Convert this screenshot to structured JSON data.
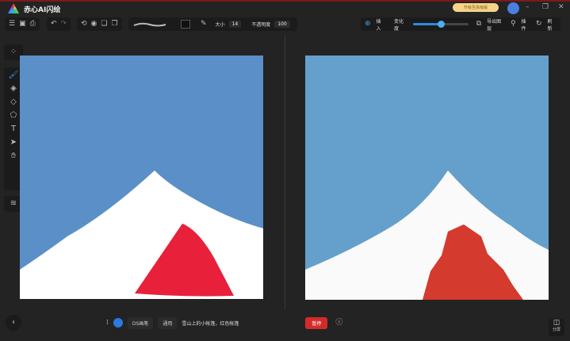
{
  "app": {
    "title": "赤心AI闪绘",
    "upgrade_label": "升级至高级版"
  },
  "toolbar": {
    "size_label": "大小",
    "size_value": "14",
    "opacity_label": "不透明度",
    "opacity_value": "100"
  },
  "right_toolbar": {
    "insert_label": "插入",
    "variation_label": "变化度",
    "variation_value": 0.5,
    "export_label": "导出图层",
    "plugin_label": "插件",
    "refresh_label": "刷新"
  },
  "bottom": {
    "brush_label": "DS画笔",
    "style_label": "通用",
    "prompt": "雪山上的小帐篷，红色帐篷",
    "pause_label": "暂停",
    "panel_label": "分屏"
  },
  "colors": {
    "sky_left": "#5b8fc7",
    "sky_right": "#65a0cc",
    "tent_left": "#e8203a",
    "tent_right": "#d43a2e",
    "accent": "#2a8ae0"
  }
}
